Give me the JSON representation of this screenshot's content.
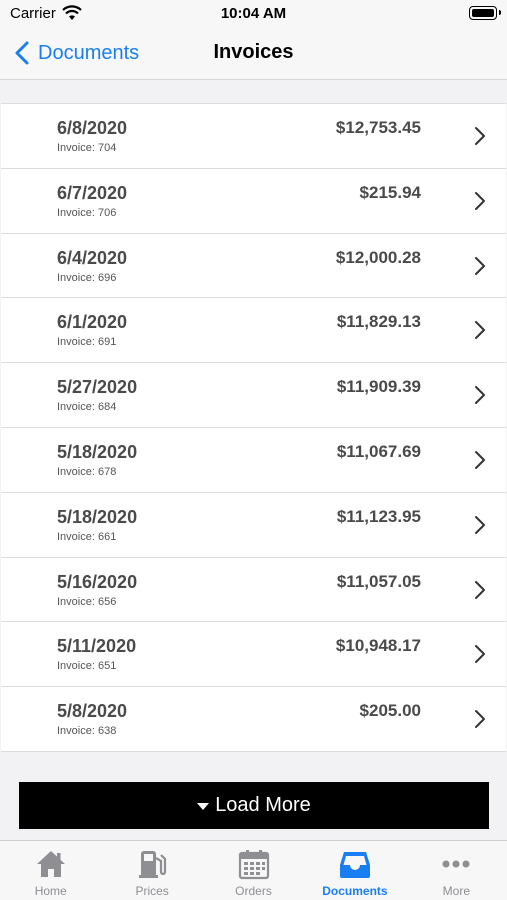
{
  "status_bar": {
    "carrier": "Carrier",
    "time": "10:04 AM"
  },
  "nav": {
    "back_label": "Documents",
    "title": "Invoices"
  },
  "invoices": [
    {
      "date": "6/8/2020",
      "invoice": "Invoice: 704",
      "amount": "$12,753.45"
    },
    {
      "date": "6/7/2020",
      "invoice": "Invoice: 706",
      "amount": "$215.94"
    },
    {
      "date": "6/4/2020",
      "invoice": "Invoice: 696",
      "amount": "$12,000.28"
    },
    {
      "date": "6/1/2020",
      "invoice": "Invoice: 691",
      "amount": "$11,829.13"
    },
    {
      "date": "5/27/2020",
      "invoice": "Invoice: 684",
      "amount": "$11,909.39"
    },
    {
      "date": "5/18/2020",
      "invoice": "Invoice: 678",
      "amount": "$11,067.69"
    },
    {
      "date": "5/18/2020",
      "invoice": "Invoice: 661",
      "amount": "$11,123.95"
    },
    {
      "date": "5/16/2020",
      "invoice": "Invoice: 656",
      "amount": "$11,057.05"
    },
    {
      "date": "5/11/2020",
      "invoice": "Invoice: 651",
      "amount": "$10,948.17"
    },
    {
      "date": "5/8/2020",
      "invoice": "Invoice: 638",
      "amount": "$205.00"
    }
  ],
  "load_more": {
    "label": "Load More",
    "icon": "caret-down-icon"
  },
  "tabs": [
    {
      "label": "Home",
      "icon": "home-icon",
      "active": false
    },
    {
      "label": "Prices",
      "icon": "fuel-pump-icon",
      "active": false
    },
    {
      "label": "Orders",
      "icon": "calendar-icon",
      "active": false
    },
    {
      "label": "Documents",
      "icon": "inbox-icon",
      "active": true
    },
    {
      "label": "More",
      "icon": "more-icon",
      "active": false
    }
  ],
  "colors": {
    "accent": "#1a7ef3",
    "inactive": "#8e8e93",
    "button": "#000000"
  }
}
